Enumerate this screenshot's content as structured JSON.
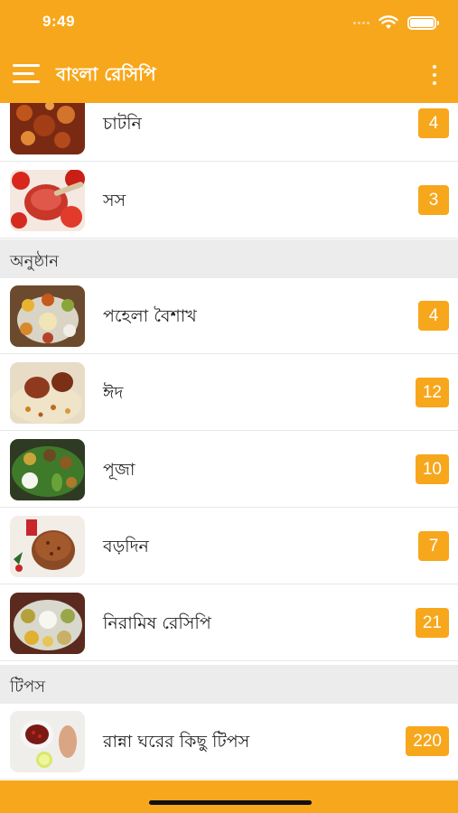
{
  "status_bar": {
    "time": "9:49"
  },
  "app_bar": {
    "title": "বাংলা রেসিপি"
  },
  "list": {
    "top_items": [
      {
        "label": "চাটনি",
        "count": "4"
      },
      {
        "label": "সস",
        "count": "3"
      }
    ],
    "sections": [
      {
        "title": "অনুষ্ঠান",
        "items": [
          {
            "label": "পহেলা বৈশাখ",
            "count": "4"
          },
          {
            "label": "ঈদ",
            "count": "12"
          },
          {
            "label": "পূজা",
            "count": "10"
          },
          {
            "label": "বড়দিন",
            "count": "7"
          },
          {
            "label": "নিরামিষ রেসিপি",
            "count": "21"
          }
        ]
      },
      {
        "title": "টিপস",
        "items": [
          {
            "label": "রান্না ঘরের কিছু টিপস",
            "count": "220"
          }
        ]
      }
    ]
  },
  "colors": {
    "accent": "#f7a71c",
    "section_bg": "#ececec"
  }
}
